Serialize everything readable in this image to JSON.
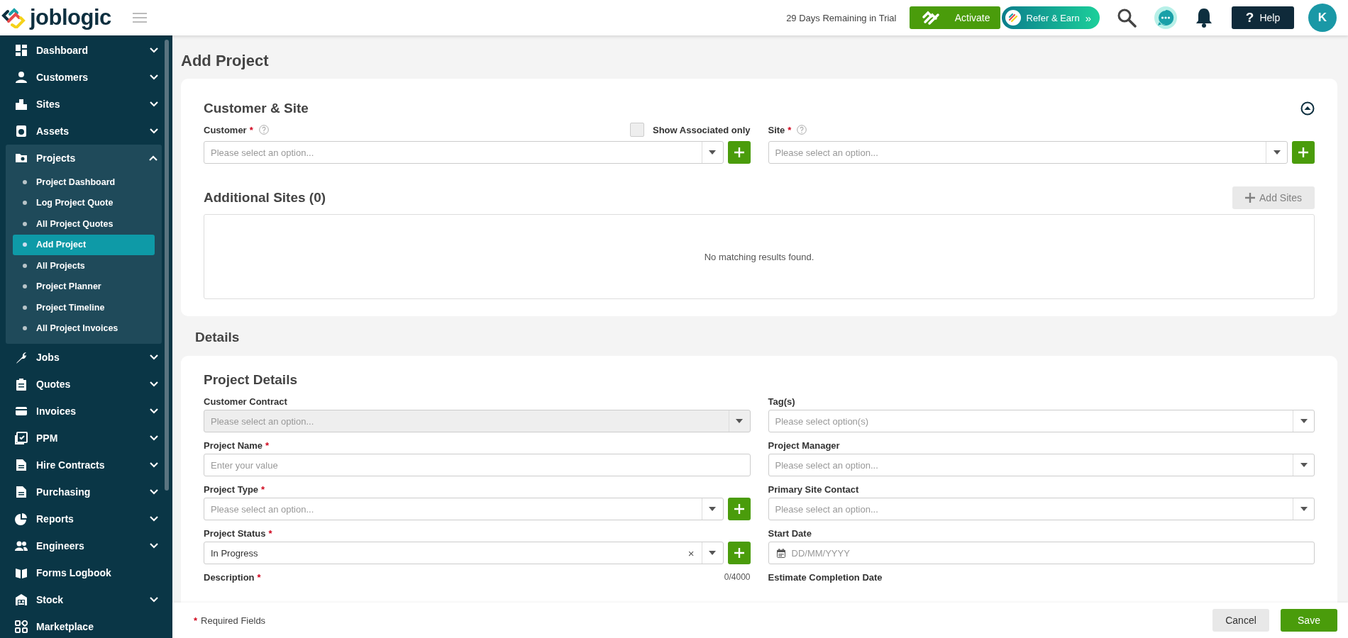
{
  "header": {
    "logo": "joblogic",
    "trial_text": "29 Days Remaining in Trial",
    "activate_label": "Activate",
    "refer_label": "Refer & Earn",
    "refer_chevron": "»",
    "help_mark": "?",
    "help_label": "Help",
    "avatar_initial": "K"
  },
  "sidebar": {
    "items": [
      {
        "label": "Dashboard",
        "kind": "grid",
        "expandable": true,
        "expanded": false
      },
      {
        "label": "Customers",
        "kind": "person",
        "expandable": true,
        "expanded": false
      },
      {
        "label": "Sites",
        "kind": "buildings",
        "expandable": true,
        "expanded": false
      },
      {
        "label": "Assets",
        "kind": "device",
        "expandable": true,
        "expanded": false
      },
      {
        "label": "Projects",
        "kind": "folder",
        "expandable": true,
        "expanded": true,
        "children": [
          {
            "label": "Project Dashboard",
            "selected": false
          },
          {
            "label": "Log Project Quote",
            "selected": false
          },
          {
            "label": "All Project Quotes",
            "selected": false
          },
          {
            "label": "Add Project",
            "selected": true
          },
          {
            "label": "All Projects",
            "selected": false
          },
          {
            "label": "Project Planner",
            "selected": false
          },
          {
            "label": "Project Timeline",
            "selected": false
          },
          {
            "label": "All Project Invoices",
            "selected": false
          }
        ]
      },
      {
        "label": "Jobs",
        "kind": "wrench",
        "expandable": true,
        "expanded": false
      },
      {
        "label": "Quotes",
        "kind": "clipboard",
        "expandable": true,
        "expanded": false
      },
      {
        "label": "Invoices",
        "kind": "card",
        "expandable": true,
        "expanded": false
      },
      {
        "label": "PPM",
        "kind": "calendar",
        "expandable": true,
        "expanded": false
      },
      {
        "label": "Hire Contracts",
        "kind": "document",
        "expandable": true,
        "expanded": false
      },
      {
        "label": "Purchasing",
        "kind": "document",
        "expandable": true,
        "expanded": false
      },
      {
        "label": "Reports",
        "kind": "pie",
        "expandable": true,
        "expanded": false
      },
      {
        "label": "Engineers",
        "kind": "people",
        "expandable": true,
        "expanded": false
      },
      {
        "label": "Forms Logbook",
        "kind": "book",
        "expandable": false,
        "expanded": false
      },
      {
        "label": "Stock",
        "kind": "warehouse",
        "expandable": true,
        "expanded": false
      },
      {
        "label": "Marketplace",
        "kind": "apps",
        "expandable": false,
        "expanded": false
      }
    ]
  },
  "page": {
    "title": "Add Project",
    "customer_site": {
      "title": "Customer & Site",
      "customer": {
        "label": "Customer",
        "required_mark": "*",
        "placeholder": "Please select an option..."
      },
      "show_associated": {
        "label": "Show Associated only",
        "checked": false
      },
      "site": {
        "label": "Site",
        "required_mark": "*",
        "placeholder": "Please select an option..."
      }
    },
    "additional_sites": {
      "title": "Additional Sites (0)",
      "add_button": {
        "label": "Add Sites",
        "disabled": true
      },
      "empty_text": "No matching results found."
    },
    "details_heading": "Details",
    "project_details": {
      "title": "Project Details",
      "left": [
        {
          "kind": "select",
          "label": "Customer Contract",
          "placeholder": "Please select an option...",
          "disabled": true
        },
        {
          "kind": "text",
          "label": "Project Name",
          "required_mark": "*",
          "placeholder": "Enter your value"
        },
        {
          "kind": "select",
          "label": "Project Type",
          "required_mark": "*",
          "placeholder": "Please select an option...",
          "add_button": true,
          "disabled": false
        },
        {
          "kind": "select",
          "label": "Project Status",
          "required_mark": "*",
          "value": "In Progress",
          "clear_mark": "×",
          "add_button": true,
          "disabled": false
        },
        {
          "kind": "textarea",
          "label": "Description",
          "required_mark": "*",
          "counter": "0/4000"
        }
      ],
      "right": [
        {
          "kind": "select",
          "label": "Tag(s)",
          "placeholder": "Please select option(s)",
          "disabled": false
        },
        {
          "kind": "select",
          "label": "Project Manager",
          "placeholder": "Please select an option...",
          "disabled": false
        },
        {
          "kind": "select",
          "label": "Primary Site Contact",
          "placeholder": "Please select an option...",
          "disabled": false
        },
        {
          "kind": "date",
          "label": "Start Date",
          "placeholder": "DD/MM/YYYY"
        },
        {
          "kind": "date",
          "label": "Estimate Completion Date"
        }
      ]
    }
  },
  "footer": {
    "required_mark": "*",
    "required_note": "Required Fields",
    "cancel": "Cancel",
    "save": "Save"
  }
}
